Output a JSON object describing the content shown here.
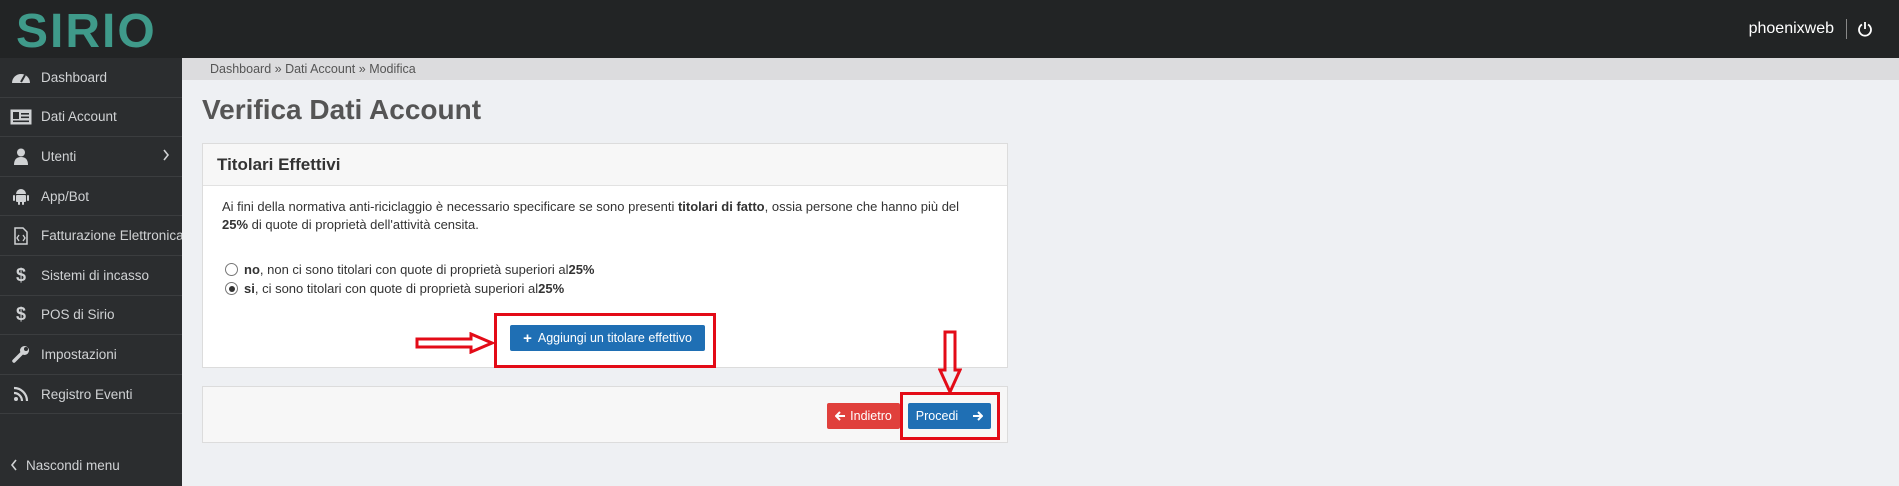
{
  "app": {
    "logo_text": "SIRIO",
    "username": "phoenixweb"
  },
  "sidebar": {
    "items": [
      {
        "label": "Dashboard",
        "icon": "dashboard-icon"
      },
      {
        "label": "Dati Account",
        "icon": "id-card-icon"
      },
      {
        "label": "Utenti",
        "icon": "user-icon"
      },
      {
        "label": "App/Bot",
        "icon": "android-icon"
      },
      {
        "label": "Fatturazione Elettronica",
        "icon": "file-code-icon"
      },
      {
        "label": "Sistemi di incasso",
        "icon": "dollar-icon"
      },
      {
        "label": "POS di Sirio",
        "icon": "dollar-icon"
      },
      {
        "label": "Impostazioni",
        "icon": "wrench-icon"
      },
      {
        "label": "Registro Eventi",
        "icon": "rss-icon"
      }
    ],
    "collapse_label": "Nascondi menu"
  },
  "breadcrumb": {
    "items": [
      "Dashboard",
      "Dati Account",
      "Modifica"
    ],
    "separator": "»"
  },
  "page": {
    "title": "Verifica Dati Account"
  },
  "panel": {
    "title": "Titolari Effettivi",
    "intro_pre": "Ai fini della normativa anti-riciclaggio è necessario specificare se sono presenti ",
    "intro_bold": "titolari di fatto",
    "intro_mid": ", ossia persone che hanno più del",
    "intro_bold2": "25%",
    "intro_post": " di quote di proprietà dell'attività censita.",
    "options": [
      {
        "bold": "no",
        "text": ", non ci sono titolari con quote di proprietà superiori al ",
        "pct": "25%",
        "checked": false
      },
      {
        "bold": "si",
        "text": ", ci sono titolari con quote di proprietà superiori al ",
        "pct": "25%",
        "checked": true
      }
    ],
    "add_button_label": "Aggiungi un titolare effettivo"
  },
  "footer": {
    "back_label": "Indietro",
    "next_label": "Procedi"
  },
  "colors": {
    "primary": "#1f6fb4",
    "danger": "#e0403c",
    "highlight": "#e30b17",
    "topbar": "#222425",
    "sidebar": "#2b2d2f",
    "logo": "#3f9a8a"
  }
}
